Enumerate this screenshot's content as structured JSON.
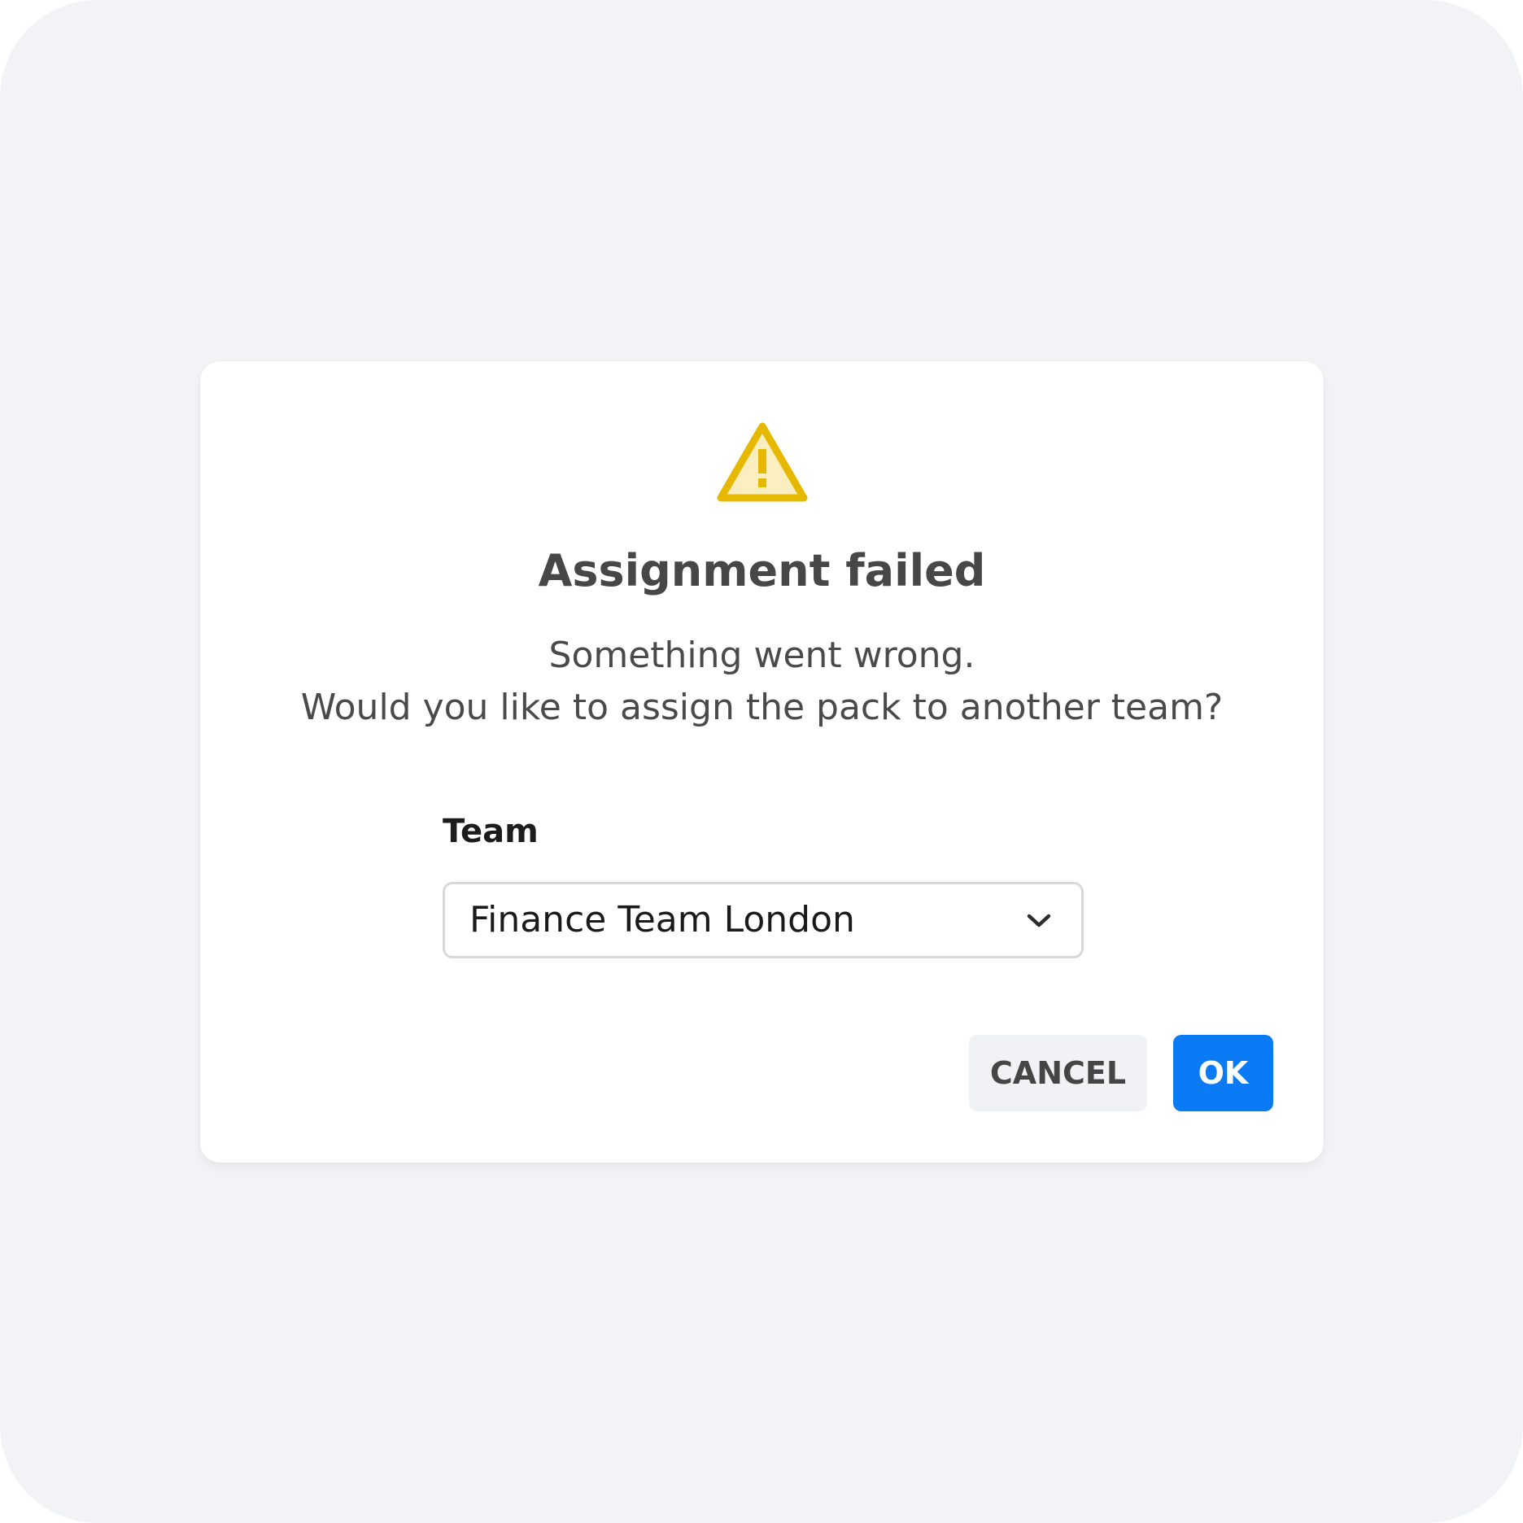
{
  "dialog": {
    "title": "Assignment failed",
    "message_line1": "Something went wrong.",
    "message_line2": "Would you like to assign the pack to another team?",
    "icon": "warning-triangle-icon",
    "icon_color": "#E6B800",
    "icon_fill": "#FBEFC2"
  },
  "team_field": {
    "label": "Team",
    "selected_value": "Finance Team London",
    "dropdown_icon": "chevron-down-icon"
  },
  "buttons": {
    "cancel_label": "CANCEL",
    "ok_label": "OK",
    "ok_color": "#0A7BF5"
  }
}
